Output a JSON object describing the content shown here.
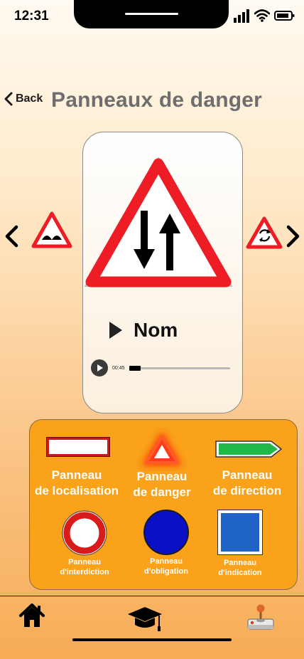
{
  "status": {
    "time": "12:31"
  },
  "header": {
    "back_label": "Back",
    "title": "Panneaux de danger"
  },
  "carousel": {
    "sign_name": "Nom",
    "audio": {
      "elapsed": "00:45",
      "progress": 0.11
    }
  },
  "categories": [
    {
      "label_line1": "Panneau",
      "label_line2": "de localisation"
    },
    {
      "label_line1": "Panneau",
      "label_line2": "de danger"
    },
    {
      "label_line1": "Panneau",
      "label_line2": "de direction"
    },
    {
      "label_line1": "Panneau",
      "label_line2": "d'interdiction"
    },
    {
      "label_line1": "Panneau",
      "label_line2": "d'obligation"
    },
    {
      "label_line1": "Panneau",
      "label_line2": "d'indication"
    }
  ],
  "colors": {
    "panel": "#f9a21a",
    "danger_red": "#ee1c24",
    "direction_green": "#21b84a",
    "obligation_blue": "#0b10c4",
    "indication_blue": "#1f63c6"
  },
  "icons": {
    "back": "chevron-left-icon",
    "prev": "chevron-left-icon",
    "next": "chevron-right-icon",
    "home": "home-icon",
    "learn": "graduation-cap-icon",
    "game": "joystick-icon"
  }
}
